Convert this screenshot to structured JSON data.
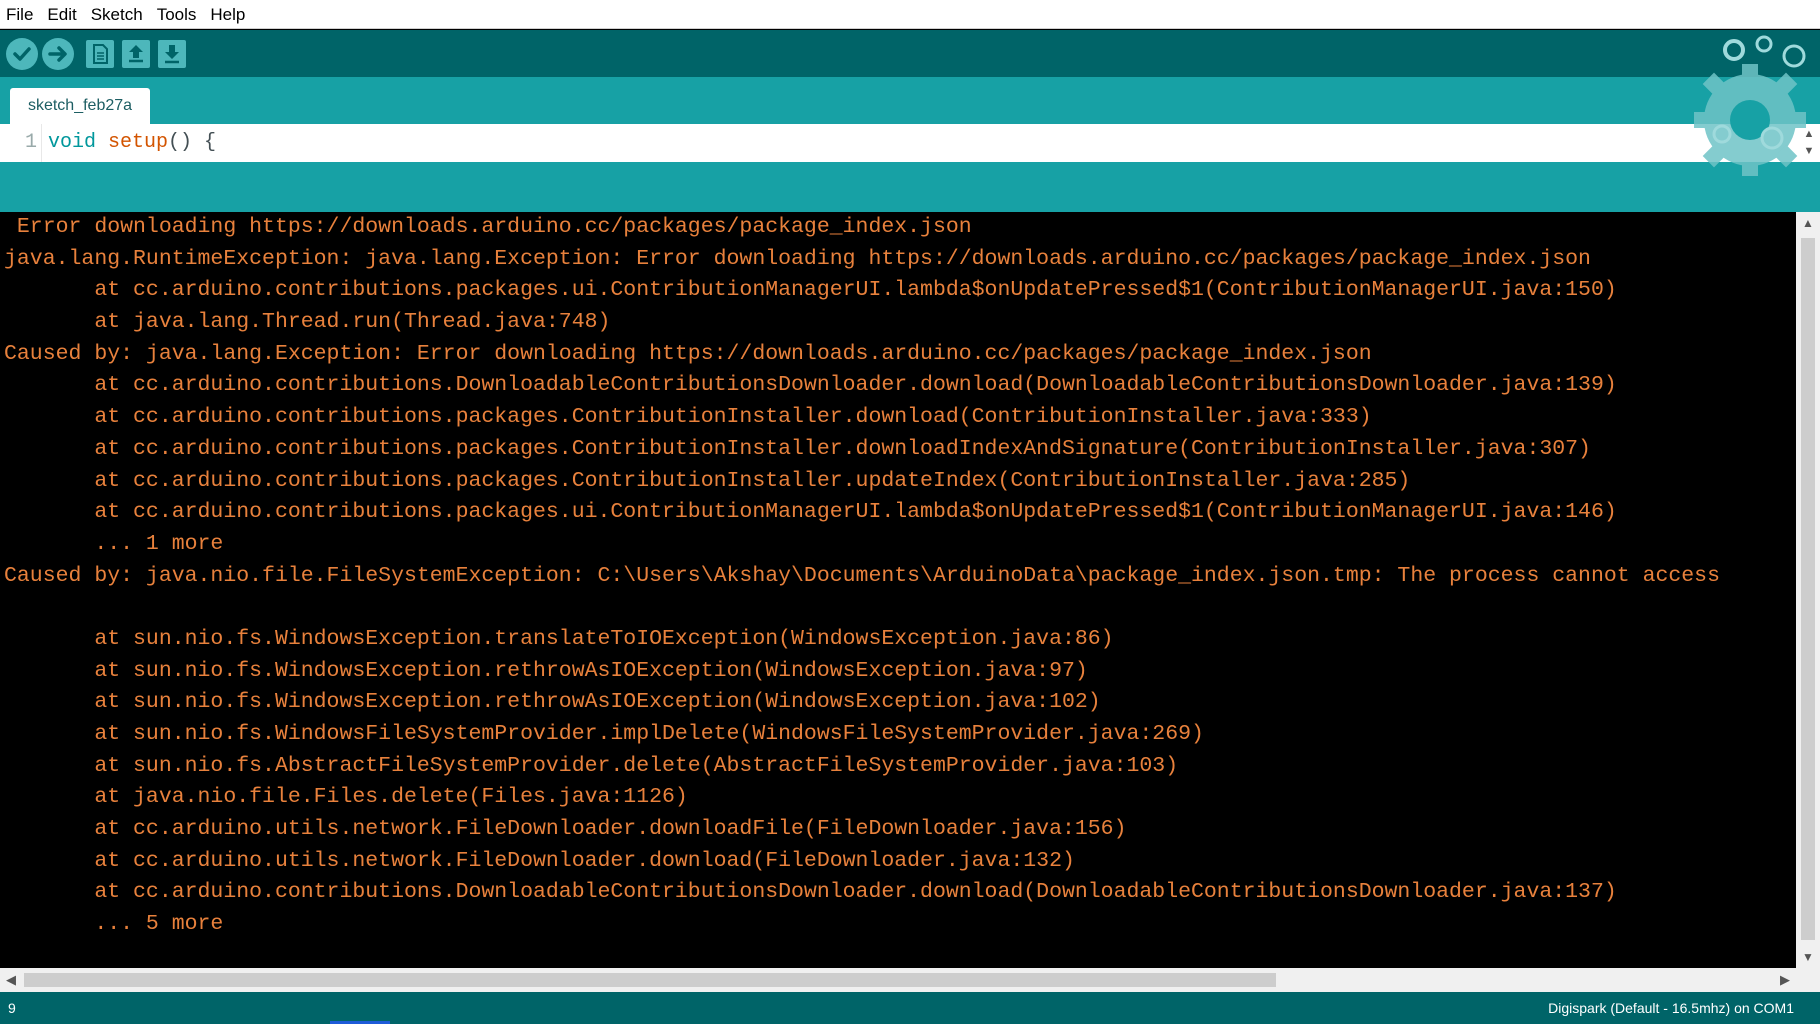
{
  "menu": {
    "items": [
      "File",
      "Edit",
      "Sketch",
      "Tools",
      "Help"
    ]
  },
  "toolbar": {
    "buttons": [
      "verify-icon",
      "upload-icon",
      "new-icon",
      "open-icon",
      "save-icon"
    ]
  },
  "tabs": {
    "active": "sketch_feb27a"
  },
  "editor": {
    "line_number": "1",
    "code_type": "void",
    "code_fn": "setup",
    "code_rest": "() {"
  },
  "console": {
    "lines": [
      " Error downloading https://downloads.arduino.cc/packages/package_index.json",
      "java.lang.RuntimeException: java.lang.Exception: Error downloading https://downloads.arduino.cc/packages/package_index.json",
      "       at cc.arduino.contributions.packages.ui.ContributionManagerUI.lambda$onUpdatePressed$1(ContributionManagerUI.java:150)",
      "       at java.lang.Thread.run(Thread.java:748)",
      "Caused by: java.lang.Exception: Error downloading https://downloads.arduino.cc/packages/package_index.json",
      "       at cc.arduino.contributions.DownloadableContributionsDownloader.download(DownloadableContributionsDownloader.java:139)",
      "       at cc.arduino.contributions.packages.ContributionInstaller.download(ContributionInstaller.java:333)",
      "       at cc.arduino.contributions.packages.ContributionInstaller.downloadIndexAndSignature(ContributionInstaller.java:307)",
      "       at cc.arduino.contributions.packages.ContributionInstaller.updateIndex(ContributionInstaller.java:285)",
      "       at cc.arduino.contributions.packages.ui.ContributionManagerUI.lambda$onUpdatePressed$1(ContributionManagerUI.java:146)",
      "       ... 1 more",
      "Caused by: java.nio.file.FileSystemException: C:\\Users\\Akshay\\Documents\\ArduinoData\\package_index.json.tmp: The process cannot access",
      "",
      "       at sun.nio.fs.WindowsException.translateToIOException(WindowsException.java:86)",
      "       at sun.nio.fs.WindowsException.rethrowAsIOException(WindowsException.java:97)",
      "       at sun.nio.fs.WindowsException.rethrowAsIOException(WindowsException.java:102)",
      "       at sun.nio.fs.WindowsFileSystemProvider.implDelete(WindowsFileSystemProvider.java:269)",
      "       at sun.nio.fs.AbstractFileSystemProvider.delete(AbstractFileSystemProvider.java:103)",
      "       at java.nio.file.Files.delete(Files.java:1126)",
      "       at cc.arduino.utils.network.FileDownloader.downloadFile(FileDownloader.java:156)",
      "       at cc.arduino.utils.network.FileDownloader.download(FileDownloader.java:132)",
      "       at cc.arduino.contributions.DownloadableContributionsDownloader.download(DownloadableContributionsDownloader.java:137)",
      "       ... 5 more"
    ]
  },
  "status": {
    "line": "9",
    "board": "Digispark (Default - 16.5mhz) on COM1"
  },
  "colors": {
    "toolbar": "#006468",
    "tabbar": "#17a1a5",
    "console_text": "#e8813c",
    "console_bg": "#000000"
  }
}
